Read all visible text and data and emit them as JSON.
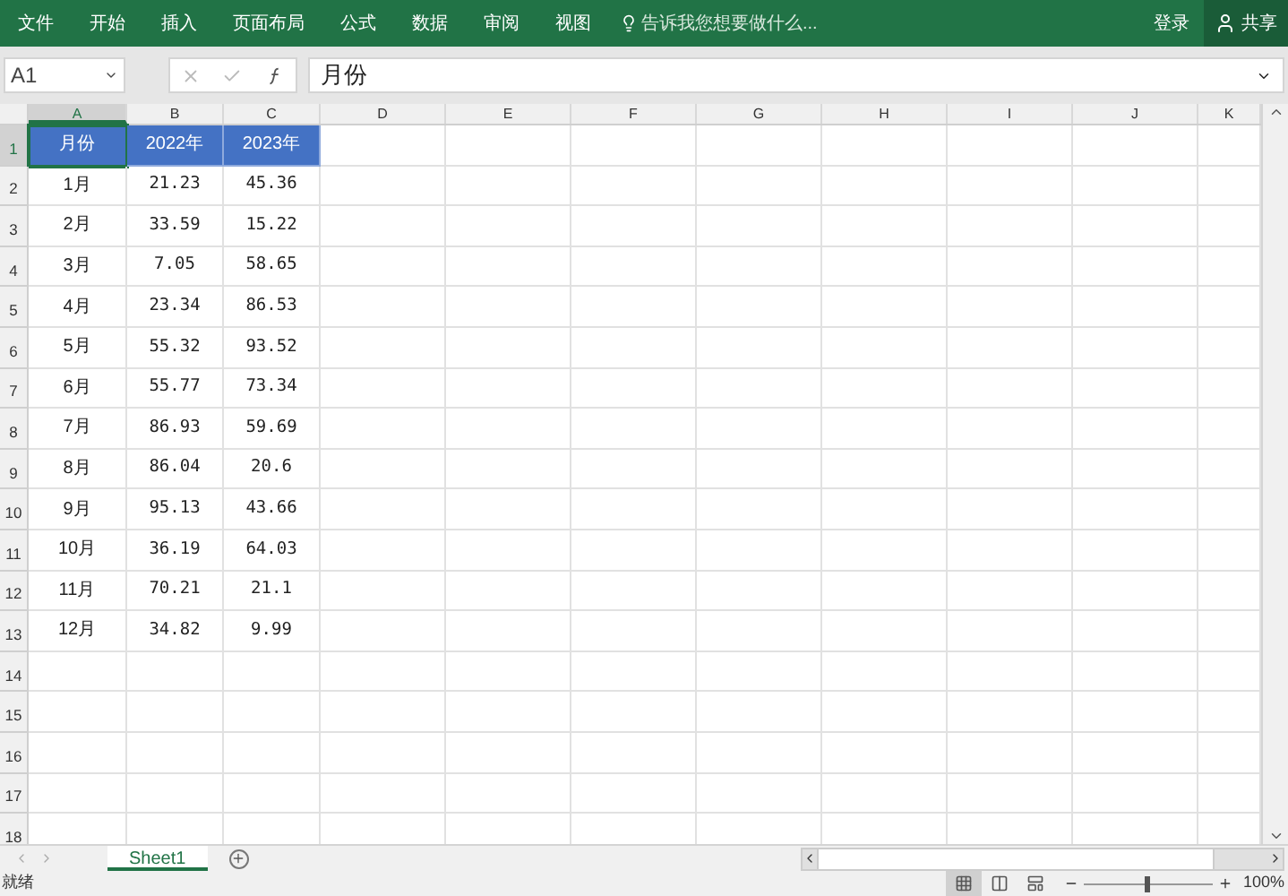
{
  "ribbon": {
    "tabs": [
      {
        "label": "文件",
        "selected": false
      },
      {
        "label": "开始",
        "selected": false
      },
      {
        "label": "插入",
        "selected": false
      },
      {
        "label": "页面布局",
        "selected": false
      },
      {
        "label": "公式",
        "selected": false
      },
      {
        "label": "数据",
        "selected": false
      },
      {
        "label": "审阅",
        "selected": false
      },
      {
        "label": "视图",
        "selected": false
      }
    ],
    "tell_me": "告诉我您想要做什么...",
    "login": "登录",
    "share": "共享"
  },
  "formula_bar": {
    "name_box": "A1",
    "value": "月份"
  },
  "columns": [
    {
      "label": "A",
      "selected": true
    },
    {
      "label": "B",
      "selected": false
    },
    {
      "label": "C",
      "selected": false
    },
    {
      "label": "D",
      "selected": false
    },
    {
      "label": "E",
      "selected": false
    },
    {
      "label": "F",
      "selected": false
    },
    {
      "label": "G",
      "selected": false
    },
    {
      "label": "H",
      "selected": false
    },
    {
      "label": "I",
      "selected": false
    },
    {
      "label": "J",
      "selected": false
    },
    {
      "label": "K",
      "selected": false
    }
  ],
  "rows": [
    {
      "number": "1",
      "selected": true,
      "kind": "header",
      "cells": [
        "月份",
        "2022年",
        "2023年"
      ]
    },
    {
      "number": "2",
      "selected": false,
      "kind": "data",
      "cells": [
        "1月",
        "21.23",
        "45.36"
      ]
    },
    {
      "number": "3",
      "selected": false,
      "kind": "data",
      "cells": [
        "2月",
        "33.59",
        "15.22"
      ]
    },
    {
      "number": "4",
      "selected": false,
      "kind": "data",
      "cells": [
        "3月",
        "7.05",
        "58.65"
      ]
    },
    {
      "number": "5",
      "selected": false,
      "kind": "data",
      "cells": [
        "4月",
        "23.34",
        "86.53"
      ]
    },
    {
      "number": "6",
      "selected": false,
      "kind": "data",
      "cells": [
        "5月",
        "55.32",
        "93.52"
      ]
    },
    {
      "number": "7",
      "selected": false,
      "kind": "data",
      "cells": [
        "6月",
        "55.77",
        "73.34"
      ]
    },
    {
      "number": "8",
      "selected": false,
      "kind": "data",
      "cells": [
        "7月",
        "86.93",
        "59.69"
      ]
    },
    {
      "number": "9",
      "selected": false,
      "kind": "data",
      "cells": [
        "8月",
        "86.04",
        "20.6"
      ]
    },
    {
      "number": "10",
      "selected": false,
      "kind": "data",
      "cells": [
        "9月",
        "95.13",
        "43.66"
      ]
    },
    {
      "number": "11",
      "selected": false,
      "kind": "data",
      "cells": [
        "10月",
        "36.19",
        "64.03"
      ]
    },
    {
      "number": "12",
      "selected": false,
      "kind": "data",
      "cells": [
        "11月",
        "70.21",
        "21.1"
      ]
    },
    {
      "number": "13",
      "selected": false,
      "kind": "data",
      "cells": [
        "12月",
        "34.82",
        "9.99"
      ]
    },
    {
      "number": "14",
      "selected": false,
      "kind": "data",
      "cells": []
    },
    {
      "number": "15",
      "selected": false,
      "kind": "data",
      "cells": []
    },
    {
      "number": "16",
      "selected": false,
      "kind": "data",
      "cells": []
    },
    {
      "number": "17",
      "selected": false,
      "kind": "data",
      "cells": []
    },
    {
      "number": "18",
      "selected": false,
      "kind": "data",
      "cells": []
    }
  ],
  "sheet_tabs": [
    {
      "label": "Sheet1",
      "selected": true
    }
  ],
  "status_bar": {
    "status": "就绪",
    "views": [
      {
        "kind": "normal",
        "selected": true
      },
      {
        "kind": "layout",
        "selected": false
      },
      {
        "kind": "pagebreak",
        "selected": false
      }
    ],
    "zoom": {
      "level": 0.5,
      "label": "100%"
    }
  }
}
